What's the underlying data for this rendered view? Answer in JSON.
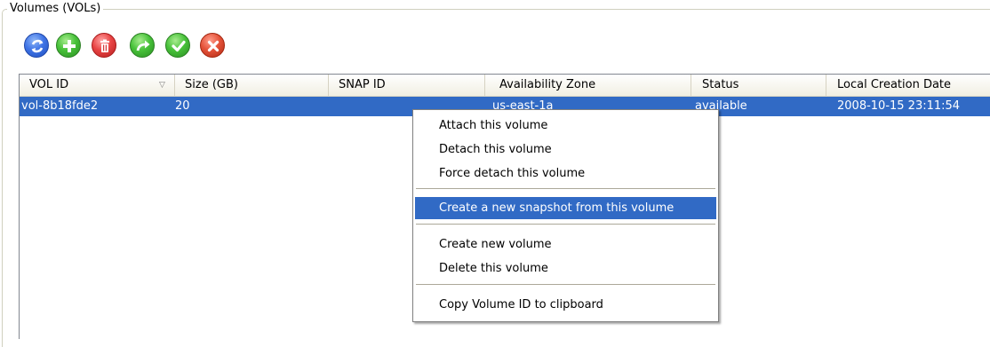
{
  "group": {
    "title": "Volumes (VOLs)"
  },
  "toolbar": {
    "buttons": [
      {
        "icon": "refresh-icon",
        "color": "#3f74e6"
      },
      {
        "icon": "add-icon",
        "color": "#48c23a"
      },
      {
        "icon": "delete-icon",
        "color": "#e94545"
      },
      {
        "icon": "forward-icon",
        "color": "#48c23a"
      },
      {
        "icon": "checkmark-icon",
        "color": "#48c23a"
      },
      {
        "icon": "cancel-icon",
        "color": "#e5533a"
      }
    ]
  },
  "table": {
    "columns": [
      "VOL ID",
      "Size (GB)",
      "SNAP ID",
      "Availability Zone",
      "Status",
      "Local Creation Date"
    ],
    "sort_indicator": "▽",
    "rows": [
      {
        "vol_id": "vol-8b18fde2",
        "size": "20",
        "snap_id": "",
        "zone": "us-east-1a",
        "status": "available",
        "created": "2008-10-15 23:11:54"
      }
    ],
    "selection_color": "#316ac5"
  },
  "context_menu": {
    "items": [
      "Attach this volume",
      "Detach this volume",
      "Force detach this volume",
      "Create a new snapshot from this volume",
      "Create new volume",
      "Delete this volume",
      "Copy Volume ID to clipboard"
    ],
    "selected_index": 3
  }
}
